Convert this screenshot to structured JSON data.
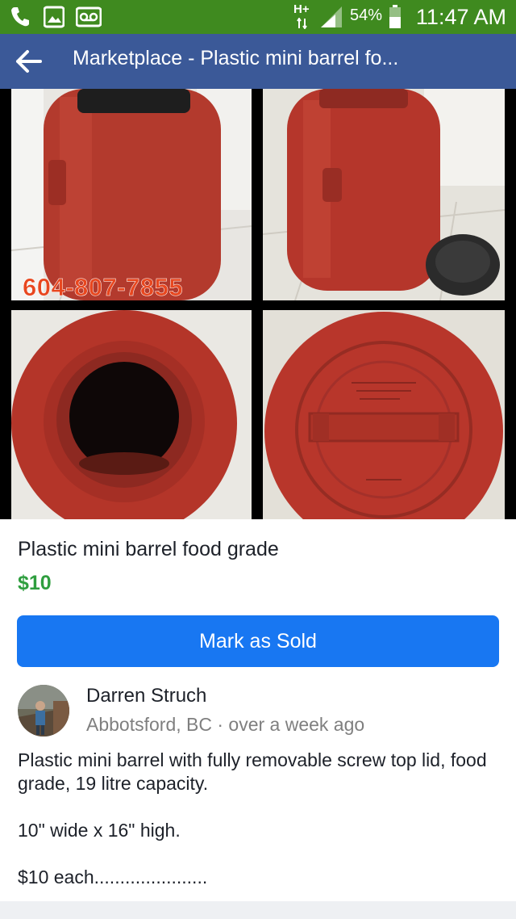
{
  "status_bar": {
    "network": "H+",
    "battery": "54%",
    "time": "11:47 AM",
    "icons": [
      "phone-icon",
      "image-icon",
      "voicemail-icon",
      "data-arrows-icon",
      "signal-icon",
      "battery-icon"
    ]
  },
  "nav": {
    "back_icon": "arrow-left-icon",
    "title": "Marketplace - Plastic mini barrel fo..."
  },
  "photo": {
    "watermark": "604-807-7855",
    "dot_count": 6,
    "active_dot_index": 5
  },
  "listing": {
    "title": "Plastic mini barrel food grade",
    "price": "$10",
    "mark_sold_label": "Mark as Sold"
  },
  "seller": {
    "name": "Darren Struch",
    "meta": "Abbotsford, BC · over a week ago"
  },
  "description": "Plastic mini barrel with fully removable screw top lid, food grade, 19 litre capacity.\n\n10\" wide x 16\" high.\n\n$10 each......................",
  "colors": {
    "status_bar": "#3f8a1f",
    "nav_bar": "#3b5998",
    "price": "#2f9e3f",
    "button": "#1877f2",
    "barrel_red": "#b8322a"
  }
}
